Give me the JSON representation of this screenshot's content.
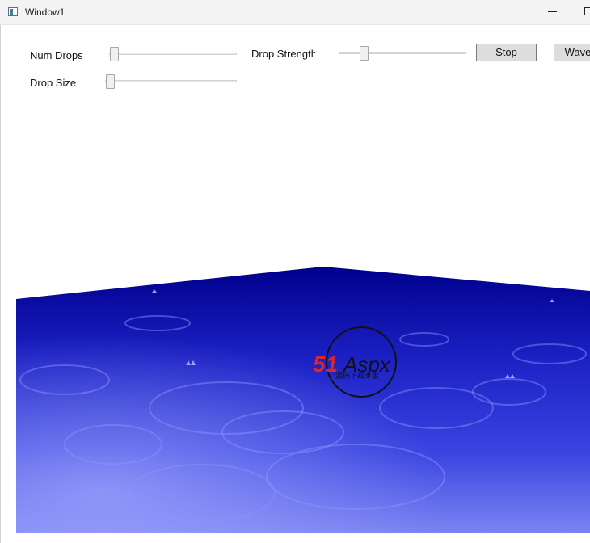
{
  "window": {
    "title": "Window1"
  },
  "controls": {
    "num_drops": {
      "label": "Num Drops",
      "value": 0.03
    },
    "drop_strength": {
      "label": "Drop Strength",
      "value": 0.2
    },
    "drop_size": {
      "label": "Drop Size",
      "value": 0.0
    },
    "stop_button": "Stop",
    "wave_button": "Wave"
  },
  "scene": {
    "description": "3D rippling water surface",
    "colors": {
      "deep": "#00008c",
      "mid": "#2a32d8",
      "light": "#8f96f5"
    }
  },
  "watermark": {
    "brand": "51Aspx",
    "tagline": "源码下载专家"
  }
}
